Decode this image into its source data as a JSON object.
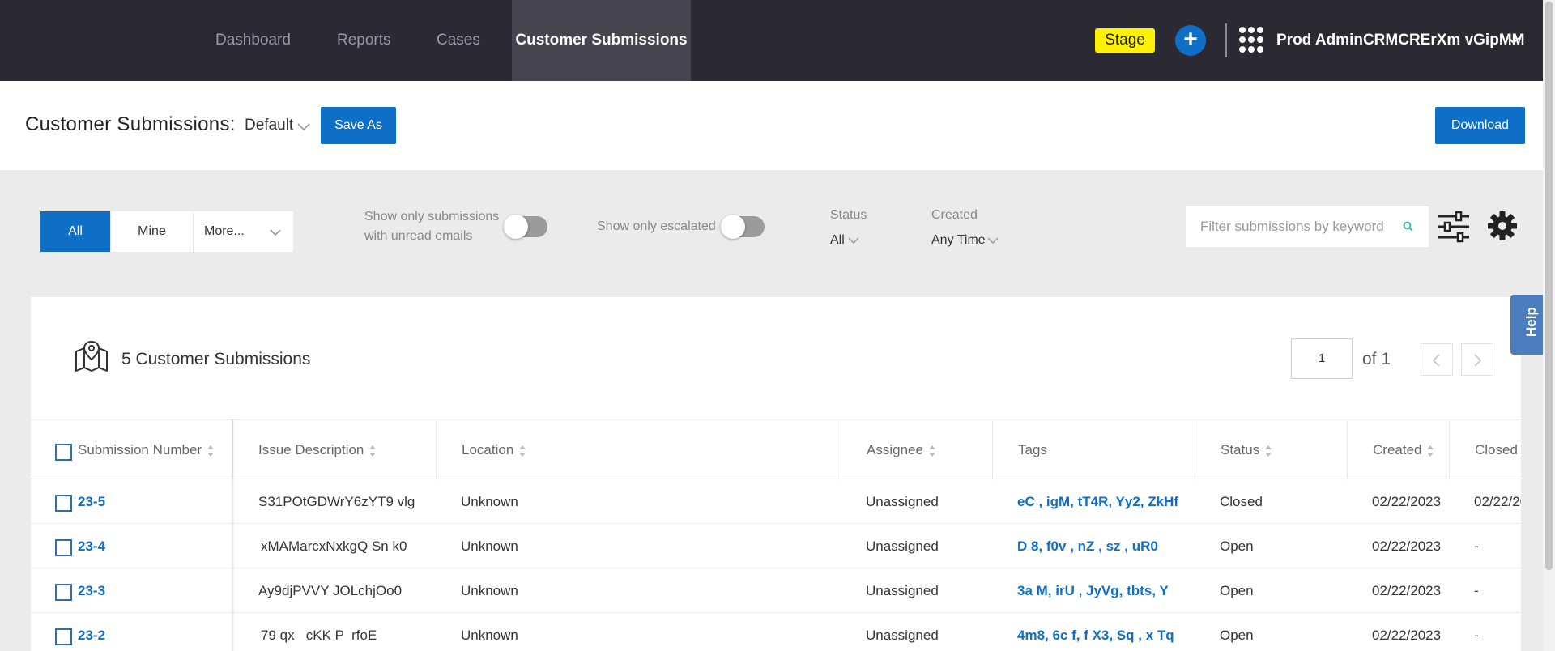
{
  "nav": {
    "items": [
      {
        "label": "Dashboard"
      },
      {
        "label": "Reports"
      },
      {
        "label": "Cases"
      },
      {
        "label": "Customer Submissions"
      }
    ],
    "stage_badge": "Stage",
    "user_name": "Prod AdminCRMCRErXm vGipMM"
  },
  "header": {
    "title": "Customer Submissions:",
    "view_name": "Default",
    "save_as": "Save As",
    "download": "Download"
  },
  "filters": {
    "segments": [
      "All",
      "Mine",
      "More..."
    ],
    "unread_toggle_label_line1": "Show only submissions",
    "unread_toggle_label_line2": "with unread emails",
    "escalated_toggle_label": "Show only escalated",
    "status_label": "Status",
    "status_value": "All",
    "created_label": "Created",
    "created_value": "Any Time",
    "search_placeholder": "Filter submissions by keyword"
  },
  "results": {
    "count_label": "5 Customer Submissions",
    "page_value": "1",
    "page_of": "of 1"
  },
  "help": "Help",
  "table": {
    "columns": [
      "Submission Number",
      "Issue Description",
      "Location",
      "Assignee",
      "Tags",
      "Status",
      "Created",
      "Closed"
    ],
    "rows": [
      {
        "number": "23-5",
        "description": "S31POtGDWrY6zYT9 vlg",
        "location": "Unknown",
        "assignee": "Unassigned",
        "tags": "eC , igM, tT4R, Yy2, ZkHf",
        "status": "Closed",
        "created": "02/22/2023",
        "closed": "02/22/20"
      },
      {
        "number": "23-4",
        "description": "xMAMarcxNxkgQ Sn k0",
        "location": "Unknown",
        "assignee": "Unassigned",
        "tags": "D 8, f0v , nZ , sz , uR0",
        "status": "Open",
        "created": "02/22/2023",
        "closed": "-"
      },
      {
        "number": "23-3",
        "description": "Ay9djPVVY JOLchjOo0",
        "location": "Unknown",
        "assignee": "Unassigned",
        "tags": "3a M, irU , JyVg, tbts, Y",
        "status": "Open",
        "created": "02/22/2023",
        "closed": "-"
      },
      {
        "number": "23-2",
        "description": "79 qx   cKK P  rfoE",
        "location": "Unknown",
        "assignee": "Unassigned",
        "tags": "4m8, 6c f, f X3, Sq , x Tq",
        "status": "Open",
        "created": "02/22/2023",
        "closed": "-"
      }
    ]
  },
  "colors": {
    "nav_bg": "#2b2a33",
    "nav_active_bg": "#45444f",
    "accent": "#0f6fc6",
    "stage_yellow": "#fff200",
    "help_tab": "#4a7cbe",
    "page_bg": "#ebebeb"
  },
  "icons": [
    "plus-icon",
    "apps-grid-icon",
    "chevron-down-icon",
    "search-icon",
    "sliders-icon",
    "gear-icon",
    "map-pin-icon",
    "chevron-left-icon",
    "chevron-right-icon",
    "sort-icon"
  ]
}
